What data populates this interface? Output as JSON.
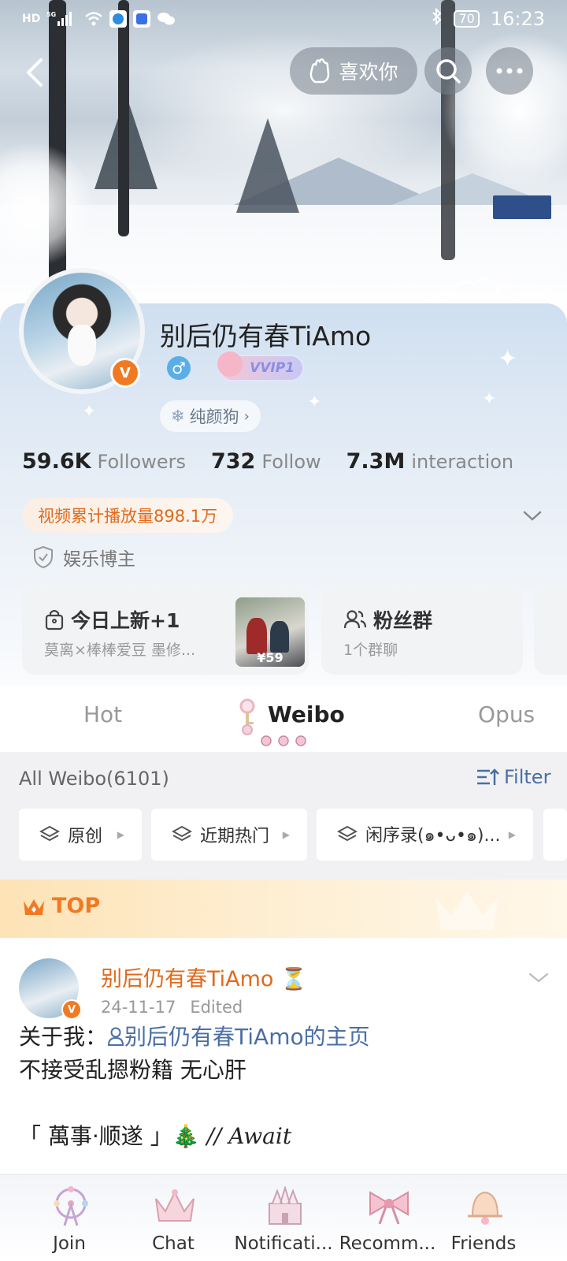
{
  "status_bar": {
    "left_badges": [
      "HD",
      "5G"
    ],
    "battery": "70",
    "time": "16:23"
  },
  "header": {
    "like_button": "喜欢你",
    "icons": [
      "back-arrow-icon",
      "like-hand-icon",
      "search-icon",
      "more-icon"
    ]
  },
  "profile": {
    "name": "别后仍有春TiAmo",
    "verified_badge": "V",
    "gender_symbol": "♂",
    "vip_label": "VVIP1",
    "tag_chip": "纯颜狗",
    "stats": [
      {
        "value": "59.6K",
        "label": "Followers"
      },
      {
        "value": "732",
        "label": "Follow"
      },
      {
        "value": "7.3M",
        "label": "interaction"
      }
    ],
    "play_count": "视频累计播放量898.1万",
    "category": "娱乐博主"
  },
  "cards": [
    {
      "title": "今日上新+1",
      "subtitle": "莫离×棒棒爱豆 墨修...",
      "price": "¥59"
    },
    {
      "title": "粉丝群",
      "subtitle": "1个群聊"
    }
  ],
  "tabs": [
    {
      "label": "Hot"
    },
    {
      "label": "Weibo"
    },
    {
      "label": "Opus"
    }
  ],
  "feed": {
    "all_weibo": "All Weibo(6101)",
    "filter_label": "Filter",
    "pills": [
      "原创",
      "近期热门",
      "闲序录(๑•ᴗ•๑)..."
    ]
  },
  "top_banner": {
    "label": "TOP"
  },
  "post": {
    "author": "别后仍有春TiAmo",
    "author_suffix": "⏳",
    "date": "24-11-17",
    "edited": "Edited",
    "line1_prefix": "关于我：",
    "line1_link": "别后仍有春TiAmo的主页",
    "line2": "不接受乱摁粉籍 无心肝",
    "line3_text": "「 萬事·顺遂 」🎄",
    "line3_tail": "// Await"
  },
  "bottom_nav": [
    {
      "label": "Join"
    },
    {
      "label": "Chat"
    },
    {
      "label": "Notificati..."
    },
    {
      "label": "Recomm..."
    },
    {
      "label": "Friends"
    }
  ],
  "colors": {
    "accent_orange": "#f07a24",
    "link_blue": "#4a6fa5",
    "vip_purple": "#8a8ee6"
  }
}
